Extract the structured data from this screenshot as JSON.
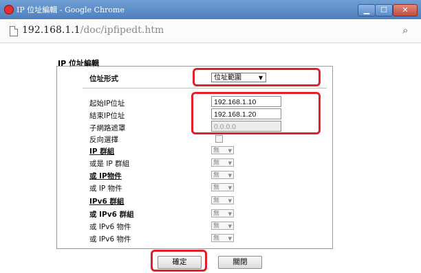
{
  "window": {
    "title": "IP 位址編輯 - Google Chrome",
    "minimize": "▁",
    "maximize": "☐",
    "close": "✕"
  },
  "address_bar": {
    "host": "192.168.1.1",
    "path": "/doc/ipfipedt.htm",
    "zoom_symbol": "⌕"
  },
  "form": {
    "heading": "IP 位址編輯",
    "address_type_label": "位址形式",
    "address_type_value": "位址範圍",
    "start_ip_label": "起始IP位址",
    "start_ip_value": "192.168.1.10",
    "end_ip_label": "結束IP位址",
    "end_ip_value": "192.168.1.20",
    "subnet_mask_label": "子網路遮罩",
    "subnet_mask_value": "0.0.0.0",
    "invert_label": "反向選擇",
    "groups": [
      {
        "label": "IP 群組",
        "value": "無"
      },
      {
        "label": "或是 IP 群組",
        "value": "無"
      },
      {
        "label": "或 IP物件",
        "value": "無"
      },
      {
        "label": "或 IP 物件",
        "value": "無"
      },
      {
        "label": "IPv6 群組",
        "value": "無"
      },
      {
        "label": "或 IPv6 群組",
        "value": "無"
      },
      {
        "label": "或 IPv6 物件",
        "value": "無"
      },
      {
        "label": "或 IPv6 物件",
        "value": "無"
      }
    ]
  },
  "buttons": {
    "ok": "確定",
    "close": "關閉"
  },
  "colors": {
    "highlight": "#e3202a",
    "titlebar": "#4f80bf"
  }
}
